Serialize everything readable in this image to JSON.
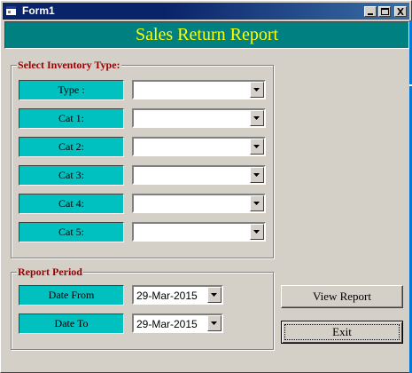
{
  "window": {
    "title": "Form1",
    "buttons": [
      "minimize",
      "maximize",
      "close"
    ]
  },
  "header": {
    "title": "Sales Return Report"
  },
  "inventory": {
    "legend": "Select Inventory Type:",
    "fields": [
      {
        "label": "Type :",
        "value": ""
      },
      {
        "label": "Cat 1:",
        "value": ""
      },
      {
        "label": "Cat 2:",
        "value": ""
      },
      {
        "label": "Cat 3:",
        "value": ""
      },
      {
        "label": "Cat 4:",
        "value": ""
      },
      {
        "label": "Cat 5:",
        "value": ""
      }
    ]
  },
  "period": {
    "legend": "Report Period",
    "date_from_label": "Date From",
    "date_from_value": "29-Mar-2015",
    "date_to_label": "Date To",
    "date_to_value": "29-Mar-2015"
  },
  "actions": {
    "view_report": "View Report",
    "exit": "Exit"
  },
  "colors": {
    "header_bg": "#008080",
    "header_text": "#ffff00",
    "label_bg": "#00c0c0",
    "legend_text": "#990000",
    "face": "#d4d0c8"
  }
}
